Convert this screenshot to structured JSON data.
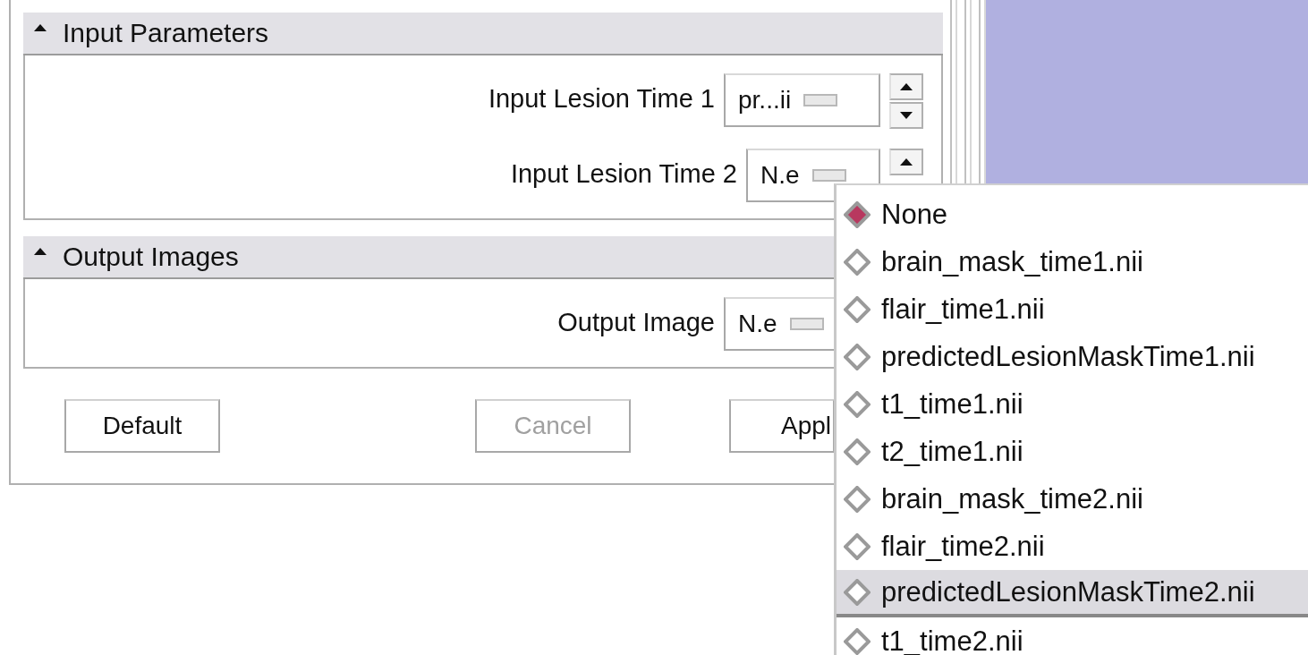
{
  "sections": [
    {
      "title": "Input Parameters",
      "expanded": true,
      "rows": [
        {
          "label": "Input Lesion Time 1",
          "value": "pr...ii",
          "spinner": {
            "up": true,
            "down": true
          }
        },
        {
          "label": "Input Lesion Time 2",
          "value": "N.e",
          "spinner": {
            "up": true,
            "down": false
          }
        }
      ]
    },
    {
      "title": "Output Images",
      "expanded": true,
      "rows": [
        {
          "label": "Output Image",
          "value": "N.e",
          "spinner": {
            "up": false,
            "down": false
          }
        }
      ]
    }
  ],
  "buttons": [
    {
      "label": "Default",
      "disabled": false
    },
    {
      "label": "Cancel",
      "disabled": true
    },
    {
      "label": "Appl",
      "disabled": false
    }
  ],
  "menu": {
    "items": [
      {
        "label": "None",
        "selected": true,
        "highlighted": false
      },
      {
        "label": "brain_mask_time1.nii",
        "selected": false,
        "highlighted": false
      },
      {
        "label": "flair_time1.nii",
        "selected": false,
        "highlighted": false
      },
      {
        "label": "predictedLesionMaskTime1.nii",
        "selected": false,
        "highlighted": false
      },
      {
        "label": "t1_time1.nii",
        "selected": false,
        "highlighted": false
      },
      {
        "label": "t2_time1.nii",
        "selected": false,
        "highlighted": false
      },
      {
        "label": "brain_mask_time2.nii",
        "selected": false,
        "highlighted": false
      },
      {
        "label": "flair_time2.nii",
        "selected": false,
        "highlighted": false
      },
      {
        "label": "predictedLesionMaskTime2.nii",
        "selected": false,
        "highlighted": true
      },
      {
        "label": "t1_time2.nii",
        "selected": false,
        "highlighted": false
      }
    ]
  }
}
